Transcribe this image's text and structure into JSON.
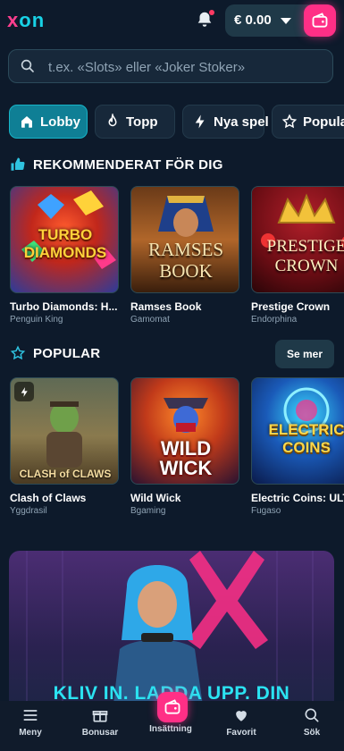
{
  "brand": {
    "logo_x": "x",
    "logo_on": "on"
  },
  "header": {
    "balance": "€ 0.00"
  },
  "search": {
    "placeholder": "t.ex. «Slots» eller «Joker Stoker»"
  },
  "tabs": [
    {
      "label": "Lobby",
      "active": true
    },
    {
      "label": "Topp",
      "active": false
    },
    {
      "label": "Nya spel",
      "active": false
    },
    {
      "label": "Popular",
      "active": false
    }
  ],
  "recommended": {
    "title": "REKOMMENDERAT FÖR DIG",
    "games": [
      {
        "name": "Turbo Diamonds: H...",
        "provider": "Penguin King",
        "art": "TURBO DIAMONDS"
      },
      {
        "name": "Ramses Book",
        "provider": "Gamomat",
        "art": "RAMSES BOOK"
      },
      {
        "name": "Prestige Crown",
        "provider": "Endorphina",
        "art": "PRESTIGE CROWN"
      }
    ]
  },
  "popular": {
    "title": "POPULAR",
    "see_more": "Se mer",
    "games": [
      {
        "name": "Clash of Claws",
        "provider": "Yggdrasil",
        "art": "CLASH of CLAWS"
      },
      {
        "name": "Wild Wick",
        "provider": "Bgaming",
        "art": "WILD WICK"
      },
      {
        "name": "Electric Coins: ULT",
        "provider": "Fugaso",
        "art": "ELECTRIC COINS"
      }
    ]
  },
  "banner": {
    "text": "KLIV IN. LADDA UPP. DIN"
  },
  "bottom_nav": [
    {
      "label": "Meny"
    },
    {
      "label": "Bonusar"
    },
    {
      "label": "Insättning"
    },
    {
      "label": "Favorit"
    },
    {
      "label": "Sök"
    }
  ],
  "colors": {
    "accent_pink": "#ff2f86",
    "accent_cyan": "#18d2e6",
    "background": "#0d1a2b"
  }
}
